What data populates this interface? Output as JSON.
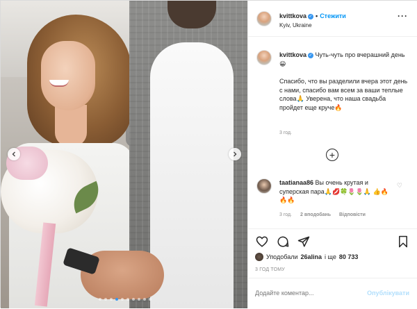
{
  "post": {
    "username": "kvittkova",
    "follow_label": "Стежити",
    "separator": "•",
    "location": "Kyiv, Ukraine",
    "more_glyph": "···",
    "verified_glyph": "✓"
  },
  "caption": {
    "username": "kvittkova",
    "title_text": "Чуть-чуть про вчерашний день😀",
    "body_text": "Спасибо, что вы разделили вчера этот день с нами, спасибо вам всем за ваши теплые слова🙏 Уверена, что наша свадьба пройдет еще круче🔥",
    "time": "3 год."
  },
  "load_more_glyph": "+",
  "comment": {
    "username": "taatianaa86",
    "text": "Вы очень крутая и суперская пара🙏💋🍀🌷🌷🙏 👍🔥🔥🔥",
    "time": "3 год.",
    "likes": "2 вподобань",
    "reply": "Відповісти",
    "heart_glyph": "♡"
  },
  "likes": {
    "prefix": "Уподобали",
    "user": "26alina",
    "suffix": "і ще",
    "count": "80 733"
  },
  "post_time": "3 ГОД ТОМУ",
  "add_comment": {
    "placeholder": "Додайте коментар...",
    "publish_label": "Опублікувати"
  },
  "carousel": {
    "total_slides": 10,
    "active_slide": 4
  },
  "colors": {
    "accent": "#0095f6",
    "verified": "#3897f0",
    "muted": "#8e8e8e",
    "publish_disabled": "#b2dffc"
  }
}
